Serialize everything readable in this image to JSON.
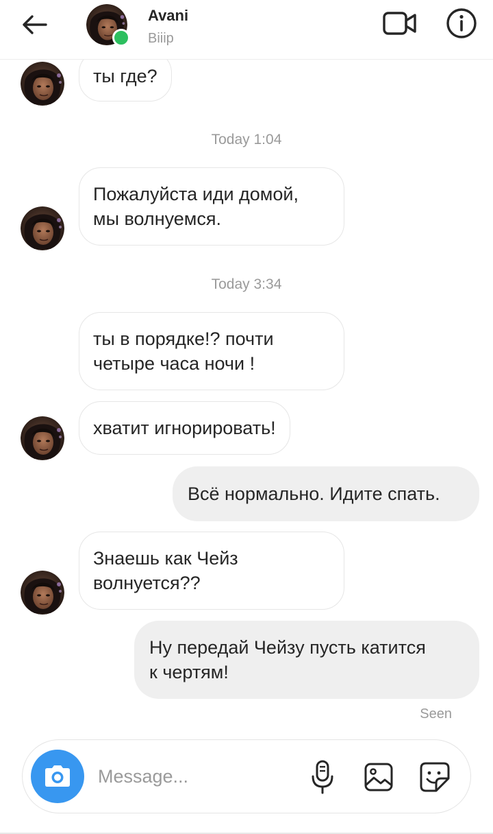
{
  "header": {
    "contact_name": "Avani",
    "status": "Biiip",
    "online": true
  },
  "composer": {
    "placeholder": "Message..."
  },
  "messages": [
    {
      "direction": "incoming",
      "text": "ты где?"
    },
    {
      "type": "timestamp",
      "text": "Today 1:04"
    },
    {
      "direction": "incoming",
      "text": "Пожалуйста иди домой,\nмы волнуемся."
    },
    {
      "type": "timestamp",
      "text": "Today 3:34"
    },
    {
      "direction": "incoming",
      "text": "ты в порядке!? почти\nчетыре часа ночи !"
    },
    {
      "direction": "incoming",
      "text": "хватит игнорировать!"
    },
    {
      "direction": "outgoing",
      "text": "Всё нормально. Идите спать."
    },
    {
      "direction": "incoming",
      "text": "Знаешь как Чейз\nволнуется??"
    },
    {
      "direction": "outgoing",
      "text": "Ну передай Чейзу пусть катится\nк чертям!"
    }
  ],
  "seen_label": "Seen",
  "icons": {
    "back": "arrow-left-icon",
    "video": "video-camera-icon",
    "info": "info-icon",
    "camera": "camera-icon",
    "mic": "microphone-icon",
    "gallery": "image-icon",
    "sticker": "sticker-icon"
  },
  "colors": {
    "accent_blue": "#3897f0",
    "online_green": "#2dbf5f",
    "outgoing_bubble": "#efefef",
    "incoming_border": "#e6e6e6",
    "muted_text": "#9a9a9a",
    "text": "#262626"
  }
}
